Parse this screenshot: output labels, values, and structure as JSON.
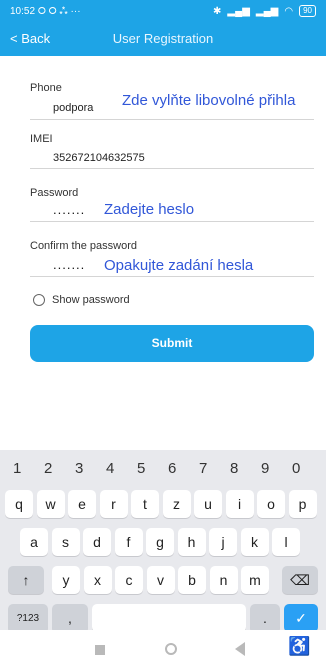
{
  "status": {
    "time": "10:52",
    "notif_icons": "⭘ ⭘ ⁂ ···",
    "battery": "90"
  },
  "appbar": {
    "back_label": "< Back",
    "title": "User Registration"
  },
  "form": {
    "phone": {
      "label": "Phone",
      "value": "podpora",
      "hint": "Zde vylňte libovolné přihla"
    },
    "imei": {
      "label": "IMEI",
      "value": "352672104632575"
    },
    "password": {
      "label": "Password",
      "value": ".......",
      "hint": "Zadejte heslo"
    },
    "confirm": {
      "label": "Confirm the password",
      "value": ".......",
      "hint": "Opakujte zadání hesla"
    },
    "show_password_label": "Show password",
    "submit_label": "Submit"
  },
  "keyboard": {
    "numbers": [
      "1",
      "2",
      "3",
      "4",
      "5",
      "6",
      "7",
      "8",
      "9",
      "0"
    ],
    "row1": [
      "q",
      "w",
      "e",
      "r",
      "t",
      "z",
      "u",
      "i",
      "o",
      "p"
    ],
    "row2": [
      "a",
      "s",
      "d",
      "f",
      "g",
      "h",
      "j",
      "k",
      "l"
    ],
    "row3": [
      "y",
      "x",
      "c",
      "v",
      "b",
      "n",
      "m"
    ],
    "shift": "↑",
    "backspace": "⌫",
    "sym": "?123",
    "comma": ",",
    "period": ".",
    "enter": "✓"
  },
  "navbar": {
    "accessibility": "♿"
  }
}
